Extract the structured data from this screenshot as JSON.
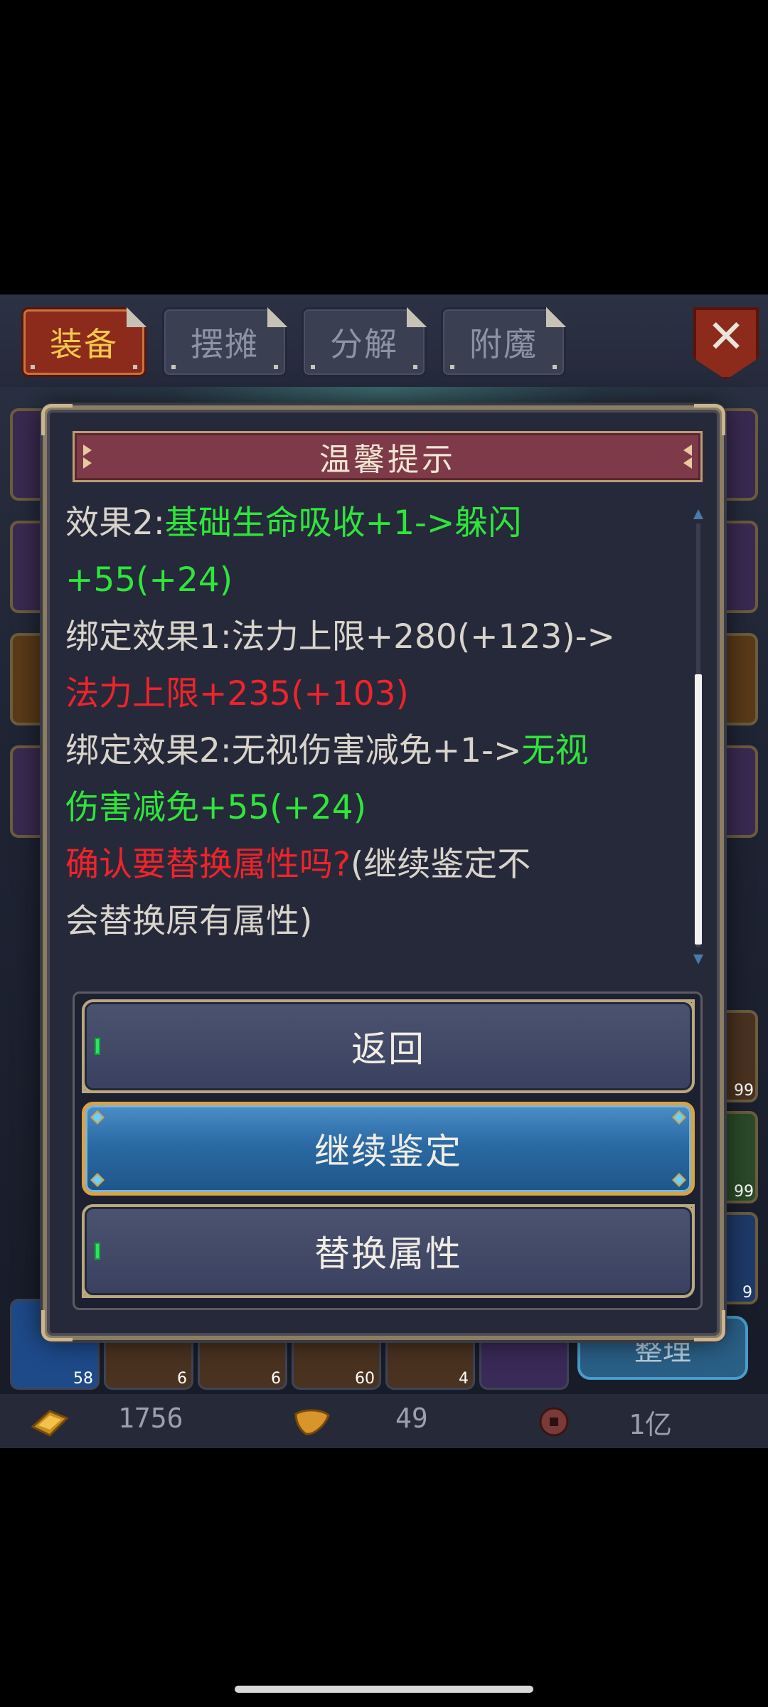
{
  "tabs": [
    {
      "label": "装备",
      "active": true
    },
    {
      "label": "摆摊",
      "active": false
    },
    {
      "label": "分解",
      "active": false
    },
    {
      "label": "附魔",
      "active": false
    }
  ],
  "close_icon": "close-x-icon",
  "inventory": {
    "stack_counts": [
      "58",
      "6",
      "6",
      "60",
      "4"
    ],
    "side_counts": [
      "99",
      "99",
      "9"
    ],
    "sort_label": "整理"
  },
  "currency": {
    "gold": "1756",
    "leaf": "49",
    "coin": "1亿"
  },
  "dialog": {
    "title": "温馨提示",
    "lines": {
      "l1a": "效果2:",
      "l1b": "基础生命吸收+1->躲闪",
      "l2": "+55(+24)",
      "l3": "绑定效果1:法力上限+280(+123)->",
      "l4": "法力上限+235(+103)",
      "l5a": "绑定效果2:无视伤害减免+1->",
      "l5b": "无视",
      "l6": "伤害减免+55(+24)",
      "l7a": "确认要替换属性吗?",
      "l7b": "(继续鉴定不",
      "l8": "会替换原有属性)"
    },
    "buttons": {
      "back": "返回",
      "continue": "继续鉴定",
      "replace": "替换属性"
    }
  },
  "colors": {
    "green": "#2ee63a",
    "red": "#f0232a",
    "accent_gold": "#d8a343"
  }
}
